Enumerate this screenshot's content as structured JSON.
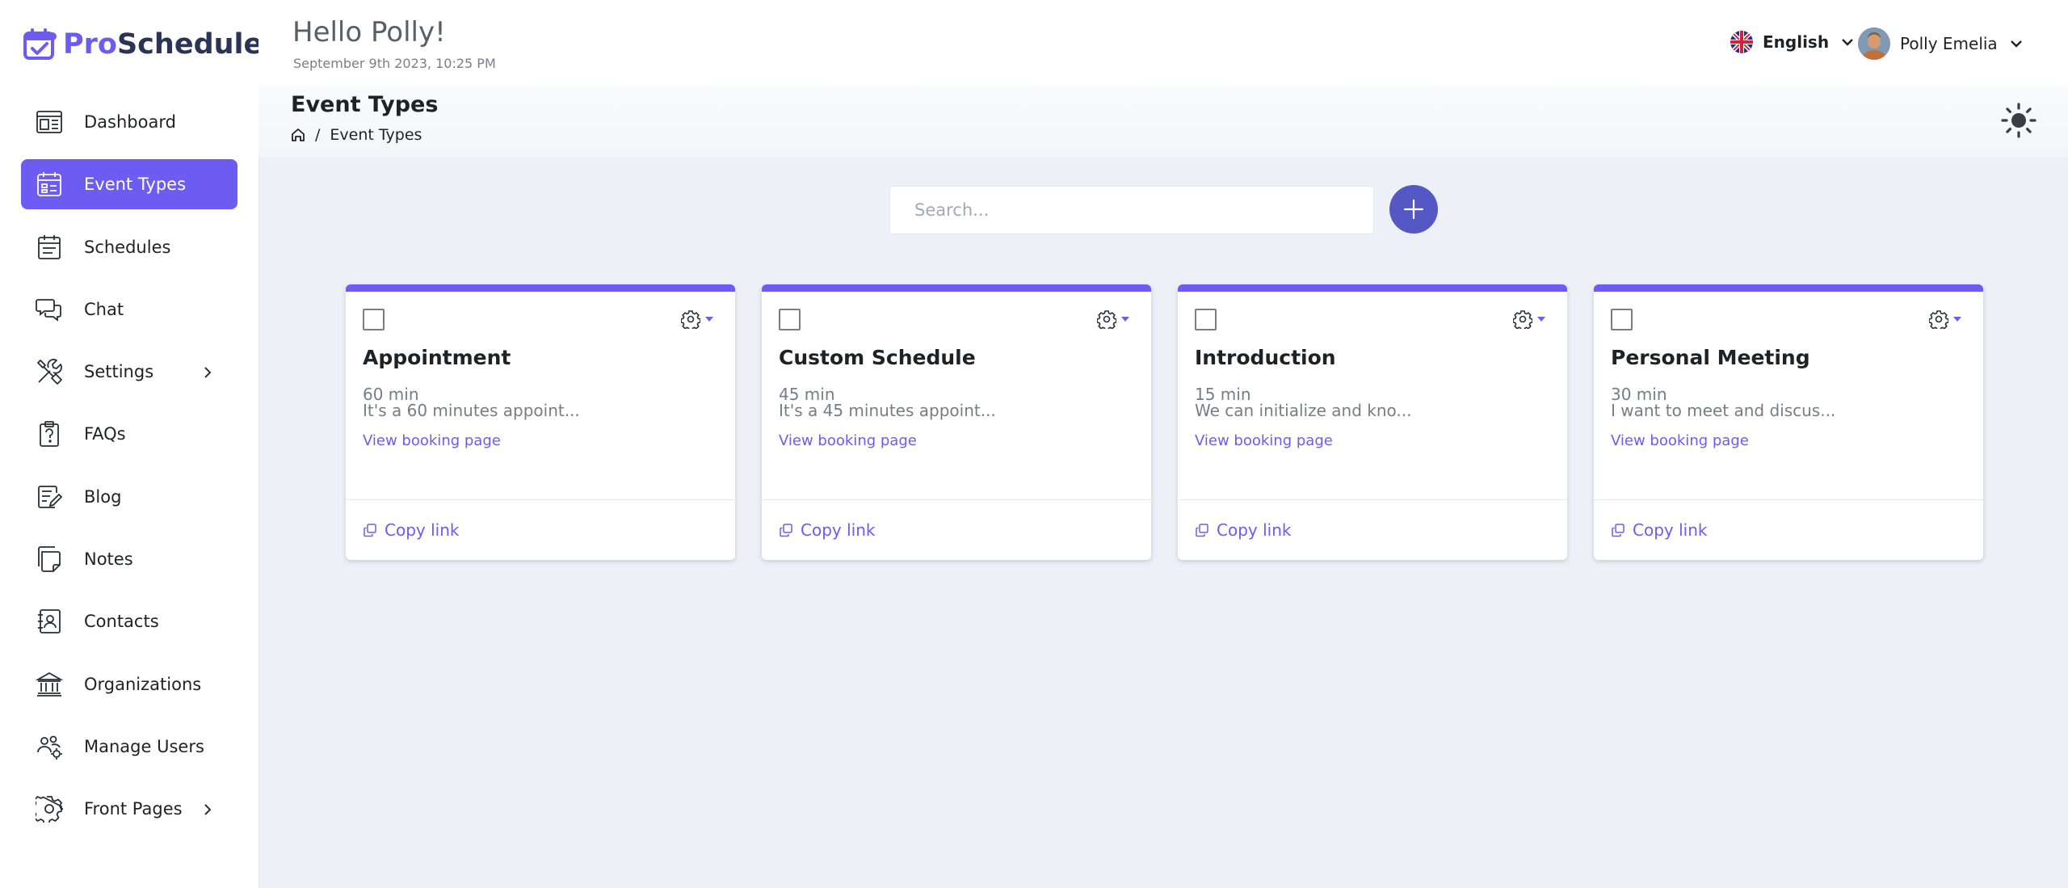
{
  "brand": {
    "pro": "Pro",
    "schedule": "Schedule",
    "accent": "#6c5cf1",
    "dark": "#2a3457"
  },
  "header": {
    "greeting": "Hello Polly!",
    "datetime": "September 9th 2023, 10:25 PM",
    "language": "English",
    "user_name": "Polly Emelia"
  },
  "sidebar": {
    "items": [
      {
        "label": "Dashboard",
        "icon": "dashboard-icon",
        "active": false,
        "has_submenu": false
      },
      {
        "label": "Event Types",
        "icon": "event-types-icon",
        "active": true,
        "has_submenu": false
      },
      {
        "label": "Schedules",
        "icon": "calendar-icon",
        "active": false,
        "has_submenu": false
      },
      {
        "label": "Chat",
        "icon": "chat-icon",
        "active": false,
        "has_submenu": false
      },
      {
        "label": "Settings",
        "icon": "tools-icon",
        "active": false,
        "has_submenu": true
      },
      {
        "label": "FAQs",
        "icon": "faq-icon",
        "active": false,
        "has_submenu": false
      },
      {
        "label": "Blog",
        "icon": "blog-icon",
        "active": false,
        "has_submenu": false
      },
      {
        "label": "Notes",
        "icon": "notes-icon",
        "active": false,
        "has_submenu": false
      },
      {
        "label": "Contacts",
        "icon": "contacts-icon",
        "active": false,
        "has_submenu": false
      },
      {
        "label": "Organizations",
        "icon": "organization-icon",
        "active": false,
        "has_submenu": false
      },
      {
        "label": "Manage Users",
        "icon": "users-icon",
        "active": false,
        "has_submenu": false
      },
      {
        "label": "Front Pages",
        "icon": "gear-icon",
        "active": false,
        "has_submenu": true
      }
    ]
  },
  "page": {
    "title": "Event Types",
    "breadcrumb": [
      "Event Types"
    ]
  },
  "search": {
    "placeholder": "Search...",
    "value": ""
  },
  "cards": [
    {
      "title": "Appointment",
      "duration": "60 min",
      "description": "It's a 60 minutes appoint...",
      "link_label": "View booking page",
      "copy_label": "Copy link"
    },
    {
      "title": "Custom Schedule",
      "duration": "45 min",
      "description": "It's a 45 minutes appoint...",
      "link_label": "View booking page",
      "copy_label": "Copy link"
    },
    {
      "title": "Introduction",
      "duration": "15 min",
      "description": "We can initialize and kno...",
      "link_label": "View booking page",
      "copy_label": "Copy link"
    },
    {
      "title": "Personal Meeting",
      "duration": "30 min",
      "description": "I want to meet and discus...",
      "link_label": "View booking page",
      "copy_label": "Copy link"
    }
  ]
}
